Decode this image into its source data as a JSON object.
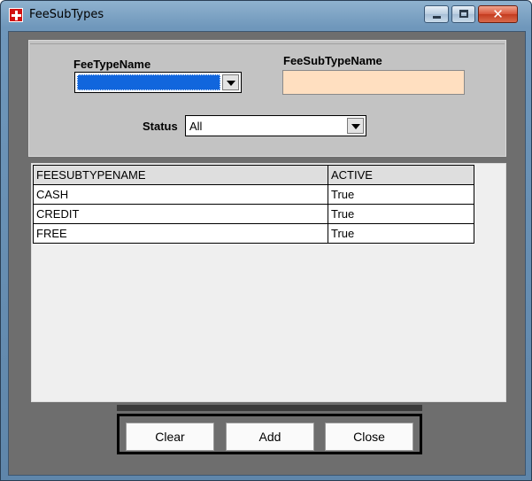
{
  "window": {
    "title": "FeeSubTypes"
  },
  "form": {
    "fee_type_label": "FeeTypeName",
    "fee_type_value": "",
    "fee_sub_type_label": "FeeSubTypeName",
    "fee_sub_type_value": "",
    "status_label": "Status",
    "status_value": "All"
  },
  "grid": {
    "columns": [
      "FEESUBTYPENAME",
      "ACTIVE"
    ],
    "rows": [
      [
        "CASH",
        "True"
      ],
      [
        "CREDIT",
        "True"
      ],
      [
        "FREE",
        "True"
      ]
    ]
  },
  "buttons": {
    "clear_label": "Clear",
    "add_label": "Add",
    "close_label": "Close"
  },
  "colors": {
    "fee_sub_type_input_bg": "#ffdfc0",
    "selected_highlight": "#1166dd",
    "close_button": "#c43b1f"
  },
  "icons": [
    "app-cross-icon",
    "minimize-icon",
    "maximize-icon",
    "close-icon",
    "dropdown-arrow-icon"
  ]
}
